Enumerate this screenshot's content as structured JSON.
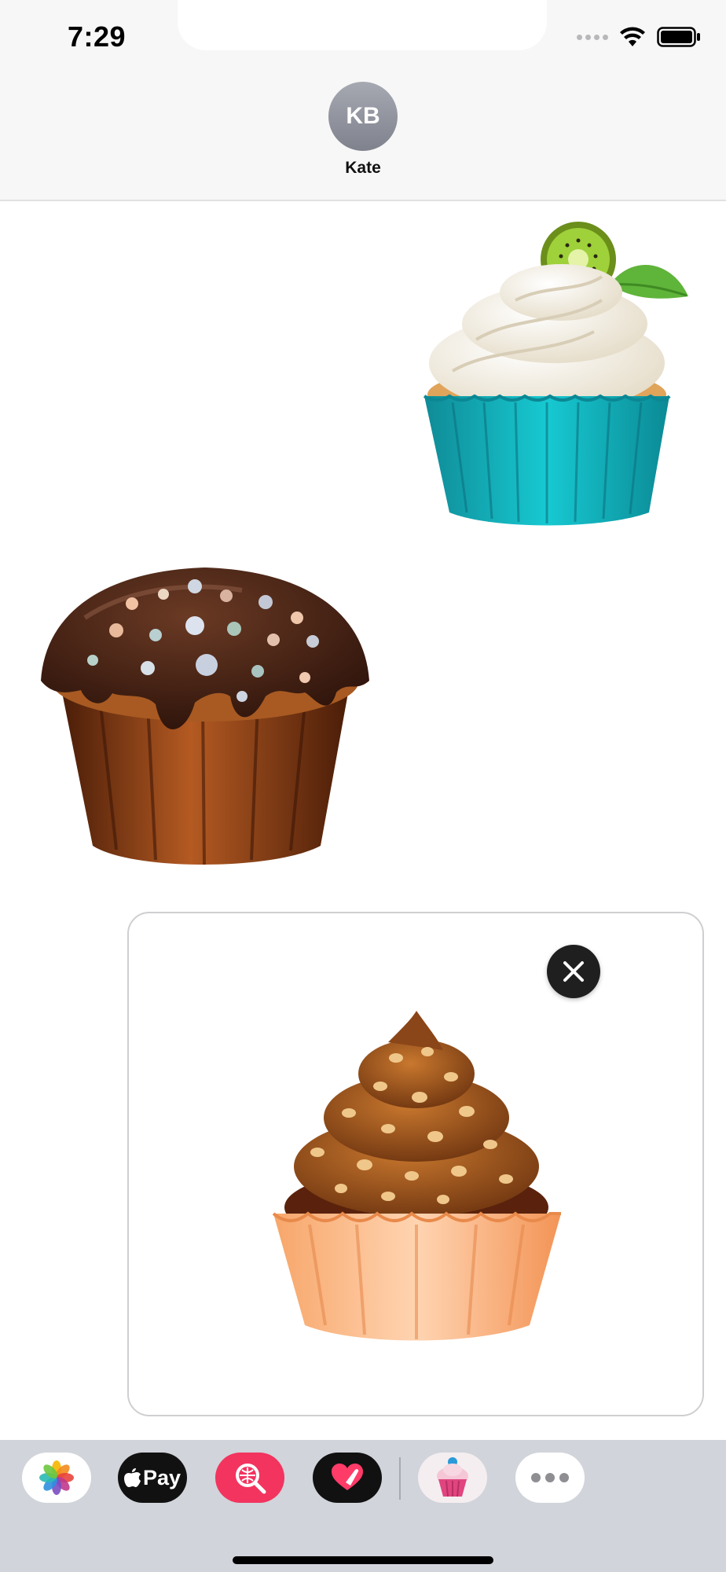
{
  "status_bar": {
    "time": "7:29",
    "icons": [
      "signal-dots-icon",
      "wifi-icon",
      "battery-icon"
    ]
  },
  "conversation": {
    "avatar_initials": "KB",
    "contact_name": "Kate"
  },
  "messages": [
    {
      "type": "sticker",
      "side": "right",
      "subject": "cupcake with whipped cream and kiwi, teal wrapper"
    },
    {
      "type": "sticker",
      "side": "left",
      "subject": "chocolate glazed muffin with pearl sprinkles"
    }
  ],
  "compose": {
    "sticker": "caramel cupcake with nuts, peach wrapper",
    "remove_icon": "close-icon"
  },
  "app_drawer": {
    "apps": [
      {
        "name": "Photos",
        "icon": "photos-icon"
      },
      {
        "name": "Apple Pay",
        "icon": "apple-pay-icon",
        "label": "Pay"
      },
      {
        "name": "Search Images",
        "icon": "image-search-icon"
      },
      {
        "name": "Digital Touch",
        "icon": "digital-touch-icon"
      },
      {
        "name": "Cupcake Stickers",
        "icon": "cupcake-app-icon"
      },
      {
        "name": "More",
        "icon": "more-icon"
      }
    ]
  },
  "colors": {
    "drawer_bg": "#d1d4da",
    "header_bg": "#f7f7f7",
    "image_search_red": "#f2345f",
    "avatar_gray": "#8e919b"
  }
}
